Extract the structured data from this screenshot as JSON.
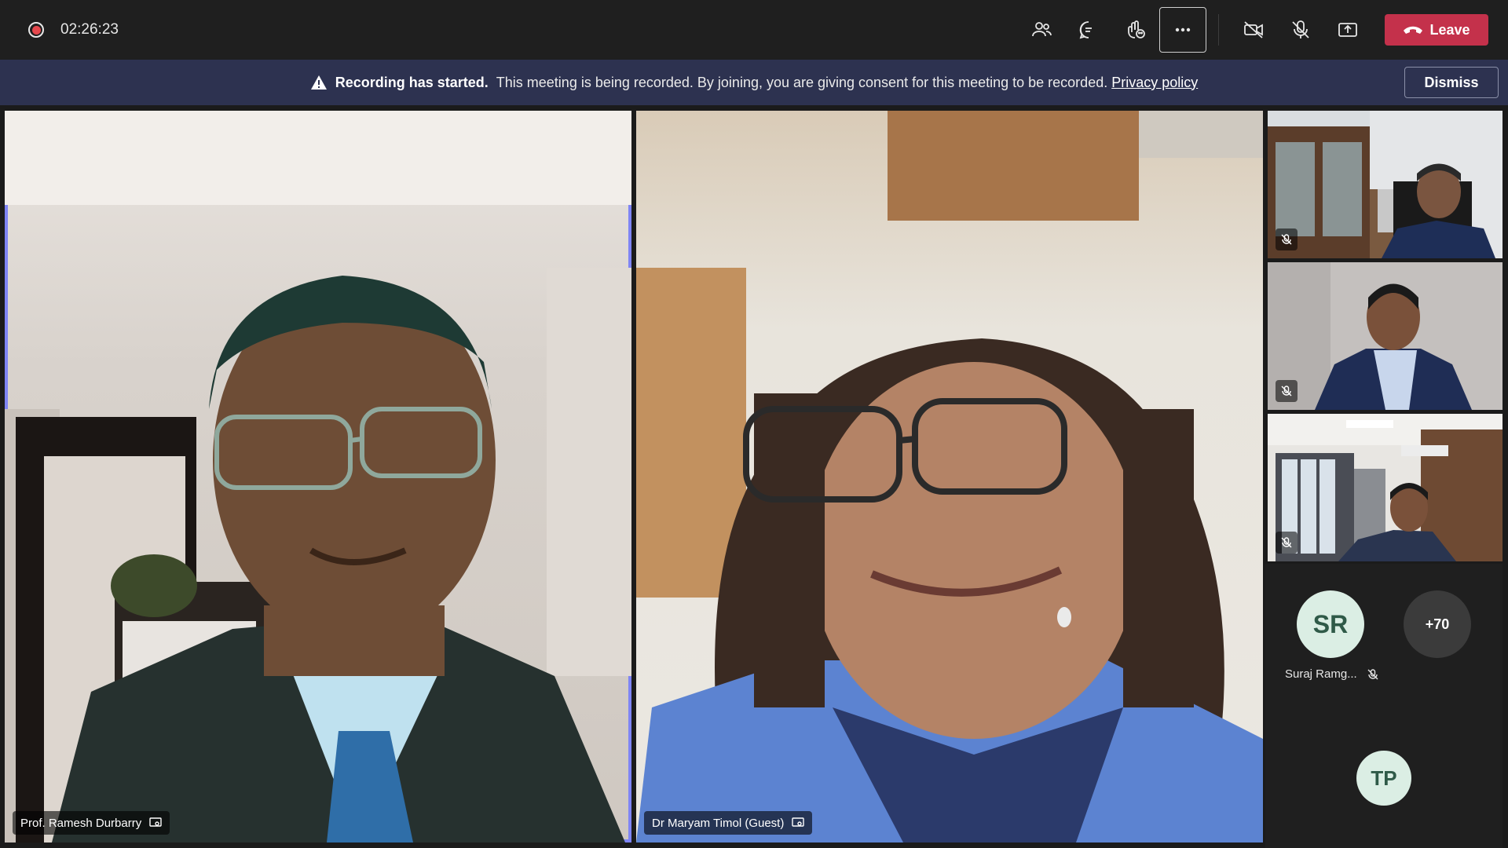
{
  "topbar": {
    "timer": "02:26:23",
    "leave_label": "Leave",
    "icons": [
      "participants-icon",
      "chat-icon",
      "reactions-icon",
      "more-icon",
      "camera-off-icon",
      "mic-off-icon",
      "share-icon",
      "phone-icon"
    ]
  },
  "banner": {
    "bold": "Recording has started.",
    "text": "This meeting is being recorded. By joining, you are giving consent for this meeting to be recorded.",
    "link": "Privacy policy",
    "dismiss_label": "Dismiss"
  },
  "participants": {
    "main": [
      {
        "name": "Prof. Ramesh Durbarry"
      },
      {
        "name": "Dr Maryam Timol (Guest)"
      }
    ],
    "side_avatars": [
      {
        "initials": "SR",
        "name": "Suraj Ramg..."
      },
      {
        "initials": "+70"
      },
      {
        "initials": "TP"
      }
    ]
  },
  "colors": {
    "accent": "#7f85f5",
    "leave": "#c4314b",
    "banner": "#2d3250",
    "avatar_bg": "#dbeee4",
    "avatar_text": "#2f5a48"
  }
}
